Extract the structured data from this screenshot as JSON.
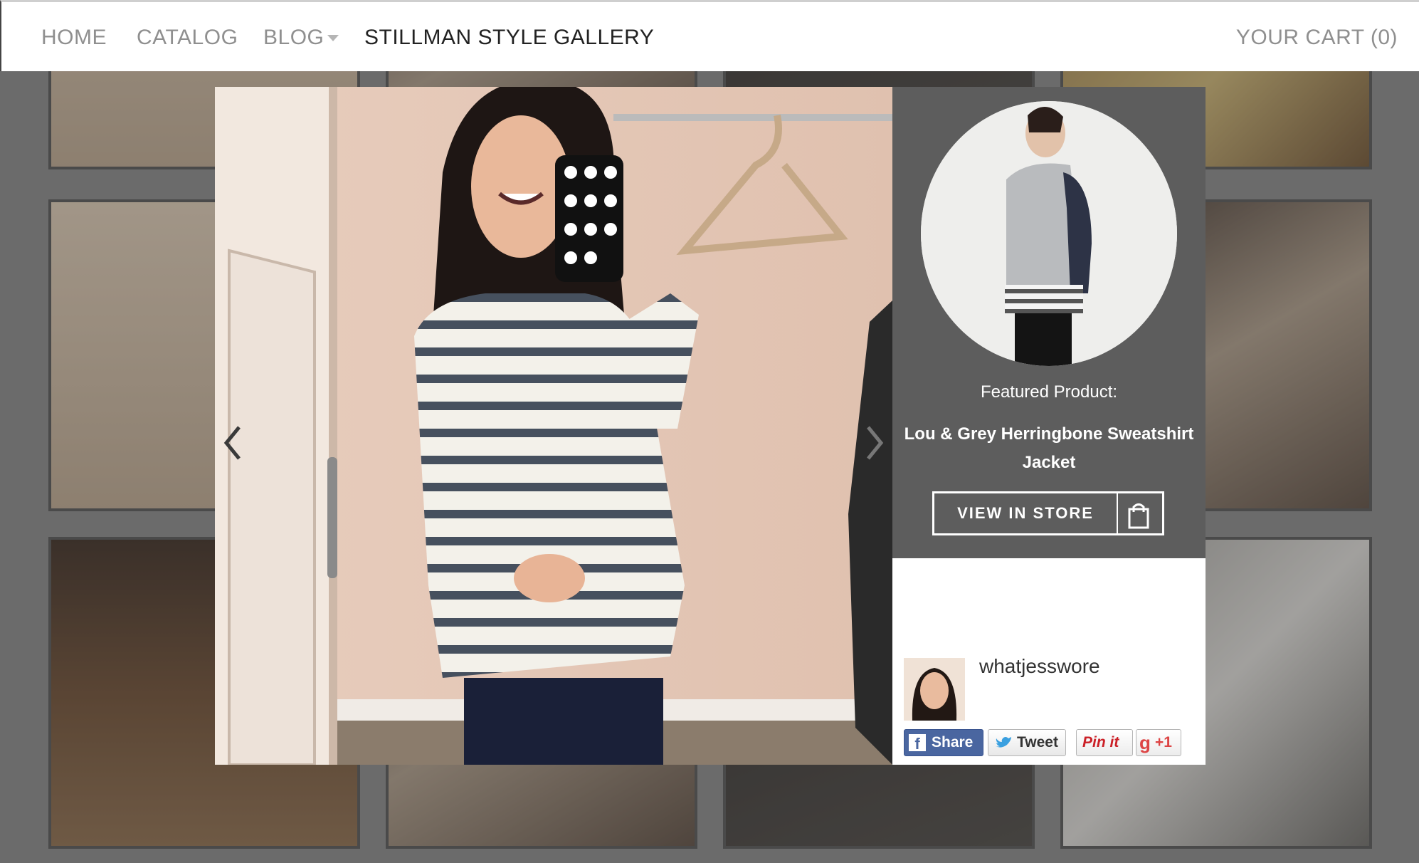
{
  "nav": {
    "home": "HOME",
    "catalog": "CATALOG",
    "blog": "BLOG",
    "gallery": "STILLMAN STYLE GALLERY",
    "cart": "YOUR CART (0)"
  },
  "modal": {
    "featured_label": "Featured Product:",
    "product_name": "Lou & Grey Herringbone Sweatshirt Jacket",
    "store_button": "VIEW IN STORE",
    "username": "whatjesswore",
    "share": {
      "facebook": "Share",
      "twitter": "Tweet",
      "pinterest": "Pin it",
      "google_plus": "+1"
    }
  },
  "colors": {
    "overlay": "#6b6b6b",
    "panel": "#5d5d5d",
    "facebook": "#4a66a0",
    "pinterest": "#cb2027"
  }
}
